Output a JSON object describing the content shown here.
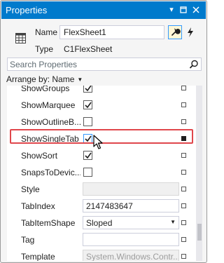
{
  "window": {
    "title": "Properties"
  },
  "header": {
    "name_label": "Name",
    "name_value": "FlexSheet1",
    "type_label": "Type",
    "type_value": "C1FlexSheet"
  },
  "search": {
    "placeholder": "Search Properties"
  },
  "arrange": {
    "label": "Arrange by: Name"
  },
  "properties": [
    {
      "name": "ShowGroups",
      "value": "",
      "checked": true,
      "kind": "checkbox"
    },
    {
      "name": "ShowMarquee",
      "value": "",
      "checked": true,
      "kind": "checkbox"
    },
    {
      "name": "ShowOutlineB...",
      "value": "",
      "checked": false,
      "kind": "checkbox"
    },
    {
      "name": "ShowSingleTab",
      "value": "",
      "checked": true,
      "kind": "checkbox",
      "highlighted": true
    },
    {
      "name": "ShowSort",
      "value": "",
      "checked": true,
      "kind": "checkbox"
    },
    {
      "name": "SnapsToDevic...",
      "value": "",
      "checked": false,
      "kind": "checkbox"
    },
    {
      "name": "Style",
      "value": "",
      "kind": "empty-disabled"
    },
    {
      "name": "TabIndex",
      "value": "2147483647",
      "kind": "text"
    },
    {
      "name": "TabItemShape",
      "value": "Sloped",
      "kind": "dropdown"
    },
    {
      "name": "Tag",
      "value": "",
      "kind": "text"
    },
    {
      "name": "Template",
      "value": "System.Windows.Contr...",
      "kind": "disabled"
    }
  ],
  "colors": {
    "titlebar": "#007acc",
    "highlight": "#e0474c"
  }
}
